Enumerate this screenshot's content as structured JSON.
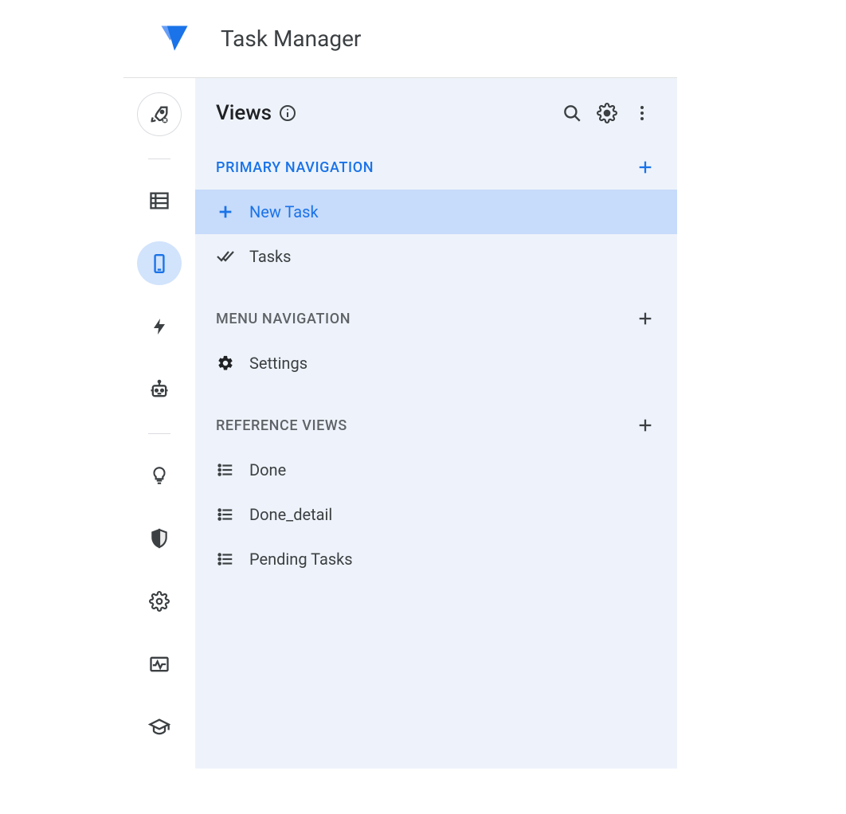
{
  "header": {
    "title": "Task Manager"
  },
  "panel": {
    "title": "Views"
  },
  "sections": {
    "primary": {
      "label": "PRIMARY NAVIGATION",
      "items": [
        {
          "label": "New Task"
        },
        {
          "label": "Tasks"
        }
      ]
    },
    "menu": {
      "label": "MENU NAVIGATION",
      "items": [
        {
          "label": "Settings"
        }
      ]
    },
    "reference": {
      "label": "REFERENCE VIEWS",
      "items": [
        {
          "label": "Done"
        },
        {
          "label": "Done_detail"
        },
        {
          "label": "Pending Tasks"
        }
      ]
    }
  }
}
